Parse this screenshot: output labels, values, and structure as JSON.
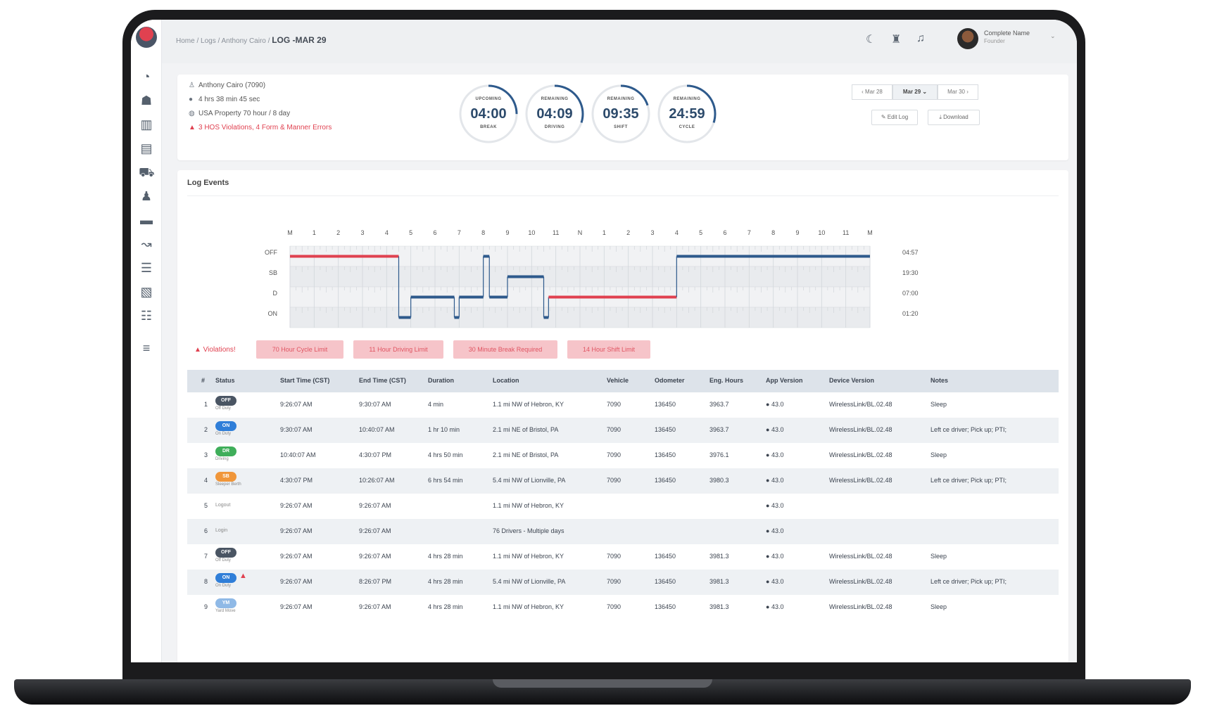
{
  "breadcrumb": {
    "path": "Home / Logs / Anthony Cairo / ",
    "current": "LOG -MAR 29"
  },
  "user": {
    "name": "Complete Name",
    "role": "Founder"
  },
  "summary": {
    "driver": "Anthony Cairo (7090)",
    "time": "4 hrs 38 min 45 sec",
    "ruleset": "USA Property 70 hour / 8 day",
    "violations": "3 HOS Violations, 4 Form & Manner Errors"
  },
  "gauges": [
    {
      "top": "UPCOMING",
      "value": "04:00",
      "bottom": "BREAK",
      "fraction": 0.25
    },
    {
      "top": "REMAINING",
      "value": "04:09",
      "bottom": "DRIVING",
      "fraction": 0.3
    },
    {
      "top": "REMAINING",
      "value": "09:35",
      "bottom": "SHIFT",
      "fraction": 0.2
    },
    {
      "top": "REMAINING",
      "value": "24:59",
      "bottom": "CYCLE",
      "fraction": 0.3
    }
  ],
  "date_nav": {
    "prev": "‹ Mar 28",
    "current": "Mar 29 ⌄",
    "next": "Mar 30 ›"
  },
  "actions": {
    "edit": "✎ Edit Log",
    "download": "⤓ Download"
  },
  "events_title": "Log Events",
  "chart": {
    "hours": [
      "M",
      "1",
      "2",
      "3",
      "4",
      "5",
      "6",
      "7",
      "8",
      "9",
      "10",
      "11",
      "N",
      "1",
      "2",
      "3",
      "4",
      "5",
      "6",
      "7",
      "8",
      "9",
      "10",
      "11",
      "M"
    ],
    "statuses": [
      "OFF",
      "SB",
      "D",
      "ON"
    ],
    "totals": [
      "04:57",
      "19:30",
      "07:00",
      "01:20"
    ]
  },
  "chart_data": {
    "type": "line",
    "title": "",
    "xlabel": "",
    "ylabel": "",
    "categories": [
      "OFF",
      "SB",
      "D",
      "ON"
    ],
    "xlim": [
      0,
      24
    ],
    "segments": [
      {
        "status": "OFF",
        "start": 0.0,
        "end": 4.5,
        "color": "#e04150"
      },
      {
        "status": "ON",
        "start": 4.5,
        "end": 5.0,
        "color": "#2e5a8c"
      },
      {
        "status": "D",
        "start": 5.0,
        "end": 6.8,
        "color": "#2e5a8c"
      },
      {
        "status": "ON",
        "start": 6.8,
        "end": 7.0,
        "color": "#2e5a8c"
      },
      {
        "status": "D",
        "start": 7.0,
        "end": 8.0,
        "color": "#2e5a8c"
      },
      {
        "status": "OFF",
        "start": 8.0,
        "end": 8.25,
        "color": "#2e5a8c"
      },
      {
        "status": "D",
        "start": 8.25,
        "end": 9.0,
        "color": "#2e5a8c"
      },
      {
        "status": "SB",
        "start": 9.0,
        "end": 10.5,
        "color": "#2e5a8c"
      },
      {
        "status": "ON",
        "start": 10.5,
        "end": 10.7,
        "color": "#2e5a8c"
      },
      {
        "status": "D",
        "start": 10.7,
        "end": 16.0,
        "color": "#e04150"
      },
      {
        "status": "OFF",
        "start": 16.0,
        "end": 24.0,
        "color": "#2e5a8c"
      }
    ]
  },
  "violations_label": "▲ Violations!",
  "violation_chips": [
    "70 Hour Cycle Limit",
    "11 Hour Driving Limit",
    "30 Minute Break Required",
    "14 Hour Shift Limit"
  ],
  "table": {
    "headers": [
      "#",
      "Status",
      "Start Time (CST)",
      "End Time (CST)",
      "Duration",
      "Location",
      "Vehicle",
      "Odometer",
      "Eng. Hours",
      "App Version",
      "Device Version",
      "Notes"
    ],
    "rows": [
      {
        "n": "1",
        "pill": "OFF",
        "sub": "Off Duty",
        "color": "#4a5563",
        "start": "9:26:07 AM",
        "end": "9:30:07 AM",
        "dur": "4 min",
        "loc": "1.1 mi NW of Hebron, KY",
        "veh": "7090",
        "odo": "136450",
        "eng": "3963.7",
        "app": " 43.0",
        "dev": "WirelessLink/BL.02.48",
        "notes": "Sleep"
      },
      {
        "n": "2",
        "pill": "ON",
        "sub": "On Duty",
        "color": "#2f7ed8",
        "start": "9:30:07 AM",
        "end": "10:40:07 AM",
        "dur": "1 hr 10 min",
        "loc": "2.1 mi NE of Bristol, PA",
        "veh": "7090",
        "odo": "136450",
        "eng": "3963.7",
        "app": " 43.0",
        "dev": "WirelessLink/BL.02.48",
        "notes": "Left ce driver; Pick up; PTI;"
      },
      {
        "n": "3",
        "pill": "DR",
        "sub": "Driving",
        "color": "#3fae5a",
        "start": "10:40:07 AM",
        "end": "4:30:07 PM",
        "dur": "4 hrs 50 min",
        "loc": "2.1 mi NE of Bristol, PA",
        "veh": "7090",
        "odo": "136450",
        "eng": "3976.1",
        "app": " 43.0",
        "dev": "WirelessLink/BL.02.48",
        "notes": "Sleep"
      },
      {
        "n": "4",
        "pill": "SB",
        "sub": "Sleeper Berth",
        "color": "#f0963a",
        "start": "4:30:07 PM",
        "end": "10:26:07 AM",
        "dur": "6 hrs 54 min",
        "loc": "5.4 mi NW of Lionville, PA",
        "veh": "7090",
        "odo": "136450",
        "eng": "3980.3",
        "app": " 43.0",
        "dev": "WirelessLink/BL.02.48",
        "notes": "Left ce driver; Pick up; PTI;"
      },
      {
        "n": "5",
        "pill": "",
        "sub": "Logout",
        "color": "",
        "start": "9:26:07 AM",
        "end": "9:26:07 AM",
        "dur": "",
        "loc": "1.1 mi NW of Hebron, KY",
        "veh": "",
        "odo": "",
        "eng": "",
        "app": " 43.0",
        "dev": "",
        "notes": ""
      },
      {
        "n": "6",
        "pill": "",
        "sub": "Login",
        "color": "",
        "start": "9:26:07 AM",
        "end": "9:26:07 AM",
        "dur": "",
        "loc": "76 Drivers - Multiple days",
        "veh": "",
        "odo": "",
        "eng": "",
        "app": " 43.0",
        "dev": "",
        "notes": ""
      },
      {
        "n": "7",
        "pill": "OFF",
        "sub": "Off Duty",
        "color": "#4a5563",
        "start": "9:26:07 AM",
        "end": "9:26:07 AM",
        "dur": "4 hrs 28 min",
        "loc": "1.1 mi NW of Hebron, KY",
        "veh": "7090",
        "odo": "136450",
        "eng": "3981.3",
        "app": " 43.0",
        "dev": "WirelessLink/BL.02.48",
        "notes": "Sleep"
      },
      {
        "n": "8",
        "pill": "ON",
        "sub": "On Duty",
        "color": "#2f7ed8",
        "start": "9:26:07 AM",
        "end": "8:26:07 PM",
        "dur": "4 hrs 28 min",
        "loc": "5.4 mi NW of Lionville, PA",
        "veh": "7090",
        "odo": "136450",
        "eng": "3981.3",
        "app": " 43.0",
        "dev": "WirelessLink/BL.02.48",
        "notes": "Left ce driver; Pick up; PTI;",
        "warn": "▲"
      },
      {
        "n": "9",
        "pill": "YM",
        "sub": "Yard Move",
        "color": "#8fb9e6",
        "start": "9:26:07 AM",
        "end": "9:26:07 AM",
        "dur": "4 hrs 28 min",
        "loc": "1.1 mi NW of Hebron, KY",
        "veh": "7090",
        "odo": "136450",
        "eng": "3981.3",
        "app": " 43.0",
        "dev": "WirelessLink/BL.02.48",
        "notes": "Sleep"
      }
    ]
  }
}
